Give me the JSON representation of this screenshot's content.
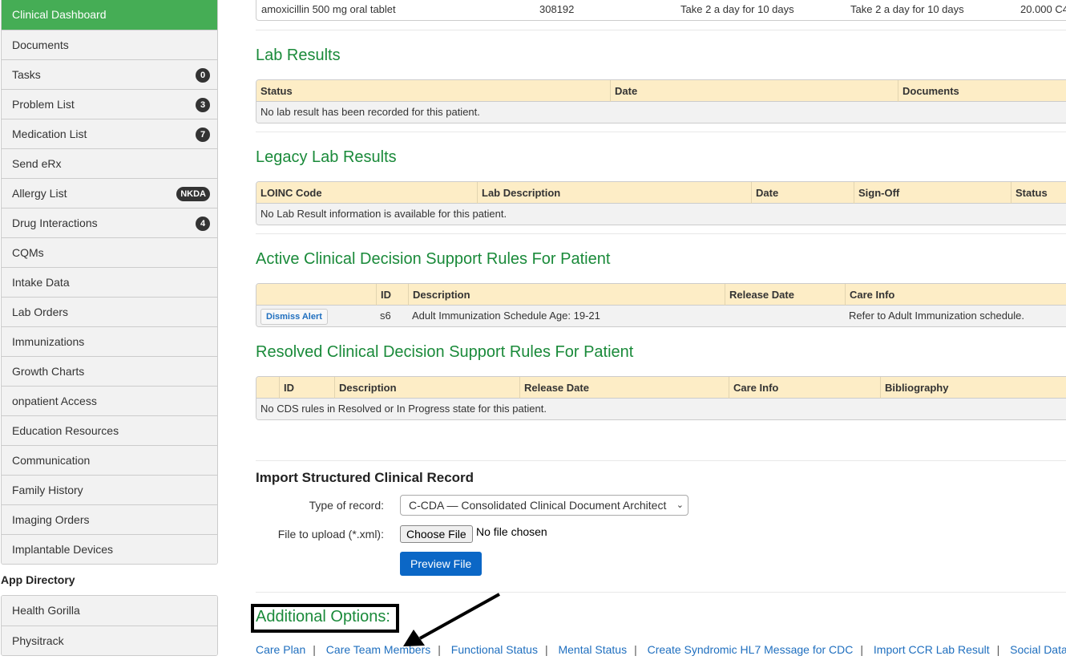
{
  "sidebar": {
    "items": [
      {
        "label": "Clinical Dashboard",
        "active": true
      },
      {
        "label": "Documents"
      },
      {
        "label": "Tasks",
        "badge": "0"
      },
      {
        "label": "Problem List",
        "badge": "3"
      },
      {
        "label": "Medication List",
        "badge": "7"
      },
      {
        "label": "Send eRx"
      },
      {
        "label": "Allergy List",
        "badge": "NKDA"
      },
      {
        "label": "Drug Interactions",
        "badge": "4"
      },
      {
        "label": "CQMs"
      },
      {
        "label": "Intake Data"
      },
      {
        "label": "Lab Orders"
      },
      {
        "label": "Immunizations"
      },
      {
        "label": "Growth Charts"
      },
      {
        "label": "onpatient Access"
      },
      {
        "label": "Education Resources"
      },
      {
        "label": "Communication"
      },
      {
        "label": "Family History"
      },
      {
        "label": "Imaging Orders"
      },
      {
        "label": "Implantable Devices"
      }
    ],
    "app_directory": {
      "heading": "App Directory",
      "items": [
        {
          "label": "Health Gorilla"
        },
        {
          "label": "Physitrack"
        }
      ]
    }
  },
  "medication_row": {
    "name": "amoxicillin 500 mg oral tablet",
    "code": "308192",
    "sig": "Take 2 a day for 10 days",
    "instructions": "Take 2 a day for 10 days",
    "qty": "20.000 C4"
  },
  "lab_results": {
    "title": "Lab Results",
    "columns": [
      "Status",
      "Date",
      "Documents"
    ],
    "empty": "No lab result has been recorded for this patient."
  },
  "legacy_lab_results": {
    "title": "Legacy Lab Results",
    "columns": [
      "LOINC Code",
      "Lab Description",
      "Date",
      "Sign-Off",
      "Status"
    ],
    "empty": "No Lab Result information is available for this patient."
  },
  "active_cds": {
    "title": "Active Clinical Decision Support Rules For Patient",
    "columns": [
      "",
      "ID",
      "Description",
      "Release Date",
      "Care Info"
    ],
    "rows": [
      {
        "action": "Dismiss Alert",
        "id": "s6",
        "description": "Adult Immunization Schedule Age: 19-21",
        "release_date": "",
        "care_info": "Refer to Adult Immunization schedule."
      }
    ]
  },
  "resolved_cds": {
    "title": "Resolved Clinical Decision Support Rules For Patient",
    "columns": [
      "",
      "ID",
      "Description",
      "Release Date",
      "Care Info",
      "Bibliography"
    ],
    "empty": "No CDS rules in Resolved or In Progress state for this patient."
  },
  "import_record": {
    "title": "Import Structured Clinical Record",
    "type_label": "Type of record:",
    "type_value": "C-CDA — Consolidated Clinical Document Architect",
    "file_label": "File to upload (*.xml):",
    "choose_file": "Choose File",
    "no_file": "No file chosen",
    "preview": "Preview File"
  },
  "additional_options": {
    "title": "Additional Options:",
    "links": [
      "Care Plan",
      "Care Team Members",
      "Functional Status",
      "Mental Status",
      "Create Syndromic HL7 Message for CDC",
      "Import CCR Lab Result",
      "Social Data"
    ]
  },
  "colors": {
    "active_nav": "#45ad55",
    "heading_green": "#1a8a3a",
    "table_header": "#fdedc6",
    "link_blue": "#1f6fbf",
    "primary_button": "#0b67c6"
  }
}
